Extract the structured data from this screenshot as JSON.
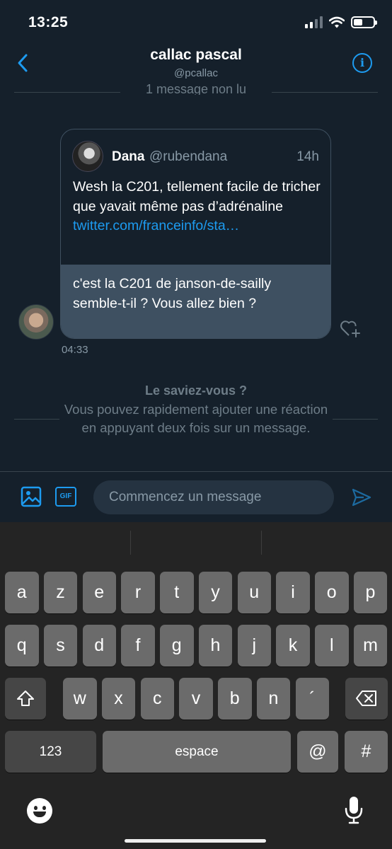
{
  "status": {
    "time": "13:25"
  },
  "header": {
    "title": "callac pascal",
    "handle": "@pcallac"
  },
  "unread": {
    "label": "1 message non lu"
  },
  "message": {
    "quoted": {
      "name": "Dana",
      "handle": "@rubendana",
      "time": "14h",
      "text": "Wesh la C201, tellement facile de tricher que yavait même pas d’adrénaline",
      "link": "twitter.com/franceinfo/sta…"
    },
    "reply": "c'est la C201 de janson-de-sailly semble-t-il ? Vous allez bien ?",
    "time": "04:33"
  },
  "tip": {
    "title": "Le saviez-vous ?",
    "body": "Vous pouvez rapidement ajouter une réaction en appuyant deux fois sur un message."
  },
  "composer": {
    "placeholder": "Commencez un message",
    "gif_label": "GIF"
  },
  "keyboard": {
    "row1": [
      "a",
      "z",
      "e",
      "r",
      "t",
      "y",
      "u",
      "i",
      "o",
      "p"
    ],
    "row2": [
      "q",
      "s",
      "d",
      "f",
      "g",
      "h",
      "j",
      "k",
      "l",
      "m"
    ],
    "row3": [
      "w",
      "x",
      "c",
      "v",
      "b",
      "n",
      "´"
    ],
    "numbers_label": "123",
    "space_label": "espace",
    "at_label": "@",
    "hash_label": "#"
  },
  "colors": {
    "background": "#15202b",
    "accent": "#1d9bf0",
    "bubble": "#3e5061"
  }
}
